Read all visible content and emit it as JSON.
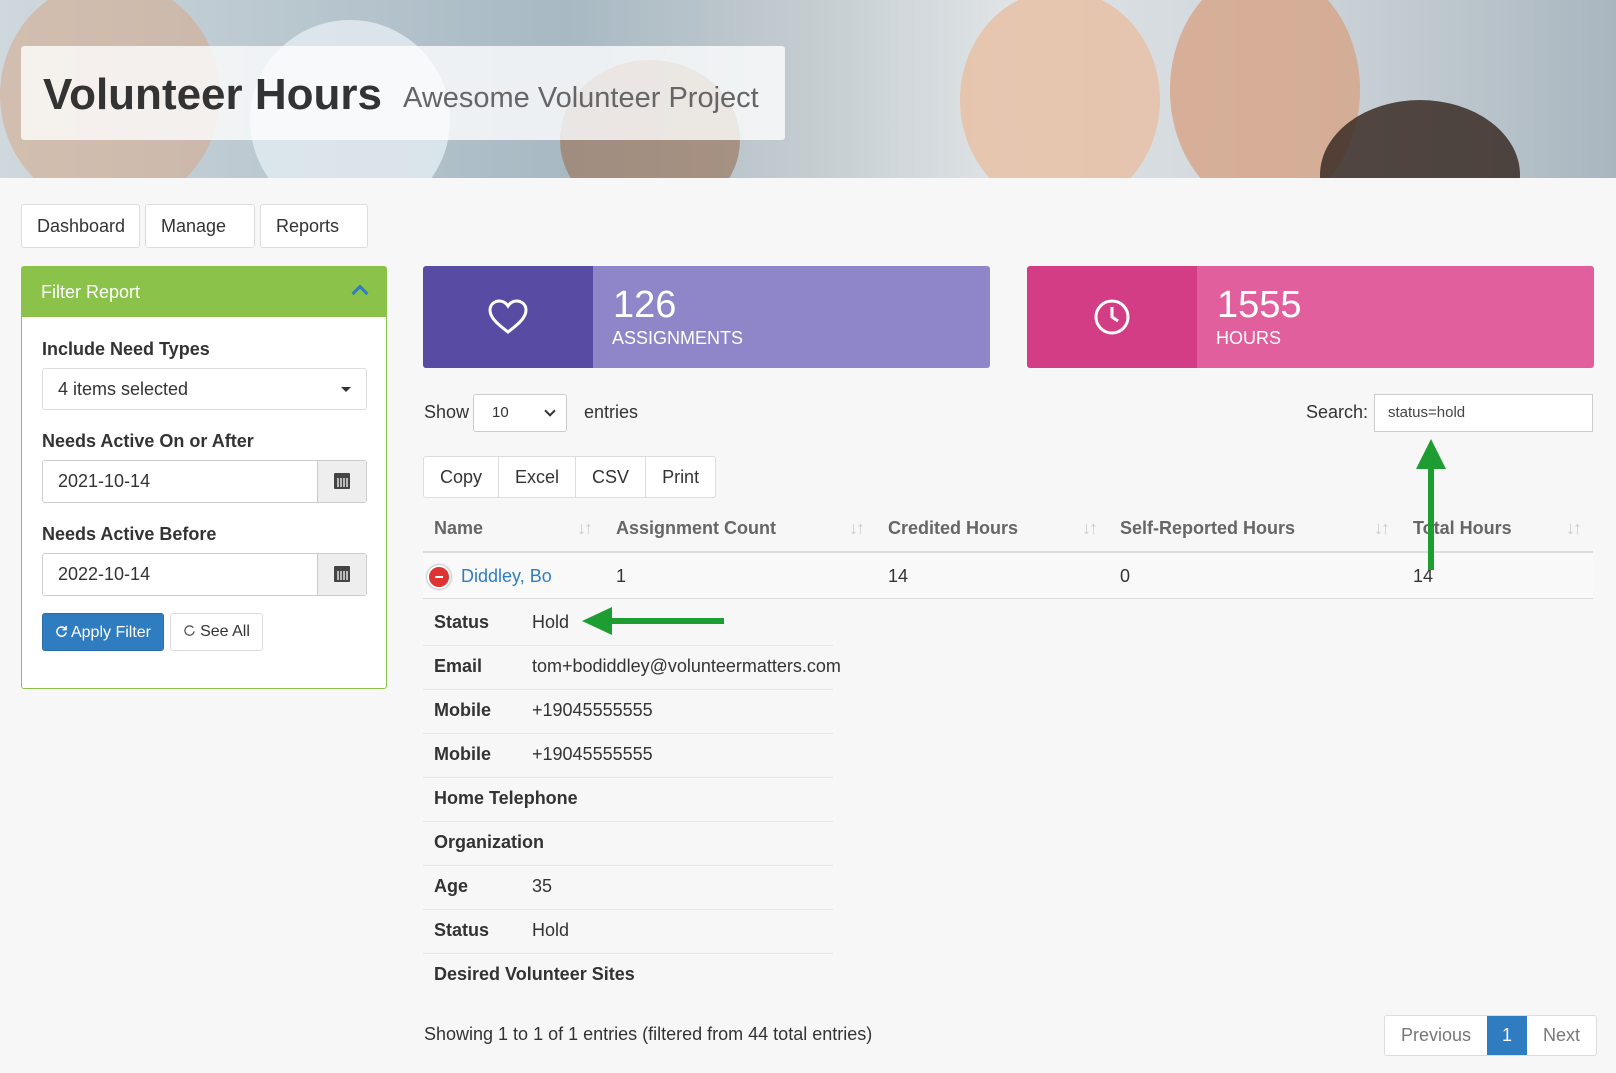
{
  "header": {
    "title": "Volunteer Hours",
    "subtitle": "Awesome Volunteer Project"
  },
  "nav": {
    "dashboard": "Dashboard",
    "manage": "Manage",
    "reports": "Reports"
  },
  "filter": {
    "title": "Filter Report",
    "need_types_label": "Include Need Types",
    "need_types_value": "4 items selected",
    "active_after_label": "Needs Active On or After",
    "active_after_value": "2021-10-14",
    "active_before_label": "Needs Active Before",
    "active_before_value": "2022-10-14",
    "apply_label": "Apply Filter",
    "see_all_label": "See All"
  },
  "stats": {
    "assignments": {
      "value": "126",
      "label": "ASSIGNMENTS",
      "colors": [
        "#574ba3",
        "#8f86c9"
      ]
    },
    "hours": {
      "value": "1555",
      "label": "HOURS",
      "colors": [
        "#d33d86",
        "#e15f9c"
      ]
    }
  },
  "table_controls": {
    "show_label": "Show",
    "length_value": "10",
    "entries_label": "entries",
    "search_label": "Search:",
    "search_value": "status=hold",
    "buttons": [
      "Copy",
      "Excel",
      "CSV",
      "Print"
    ]
  },
  "table": {
    "columns": [
      "Name",
      "Assignment Count",
      "Credited Hours",
      "Self-Reported Hours",
      "Total Hours"
    ],
    "sort_icon": "↓↑",
    "row": {
      "name": "Diddley, Bo",
      "assignment_count": "1",
      "credited_hours": "14",
      "self_reported_hours": "0",
      "total_hours": "14"
    },
    "details": [
      {
        "key": "Status",
        "value": "Hold"
      },
      {
        "key": "Email",
        "value": "tom+bodiddley@volunteermatters.com"
      },
      {
        "key": "Mobile",
        "value": "+19045555555"
      },
      {
        "key": "Mobile",
        "value": "+19045555555"
      },
      {
        "key": "Home Telephone",
        "value": ""
      },
      {
        "key": "Organization",
        "value": ""
      },
      {
        "key": "Age",
        "value": "35"
      },
      {
        "key": "Status",
        "value": "Hold"
      },
      {
        "key": "Desired Volunteer Sites",
        "value": ""
      }
    ],
    "info": "Showing 1 to 1 of 1 entries (filtered from 44 total entries)"
  },
  "pagination": {
    "previous": "Previous",
    "page": "1",
    "next": "Next"
  },
  "annotation_color": "#1e9e32"
}
